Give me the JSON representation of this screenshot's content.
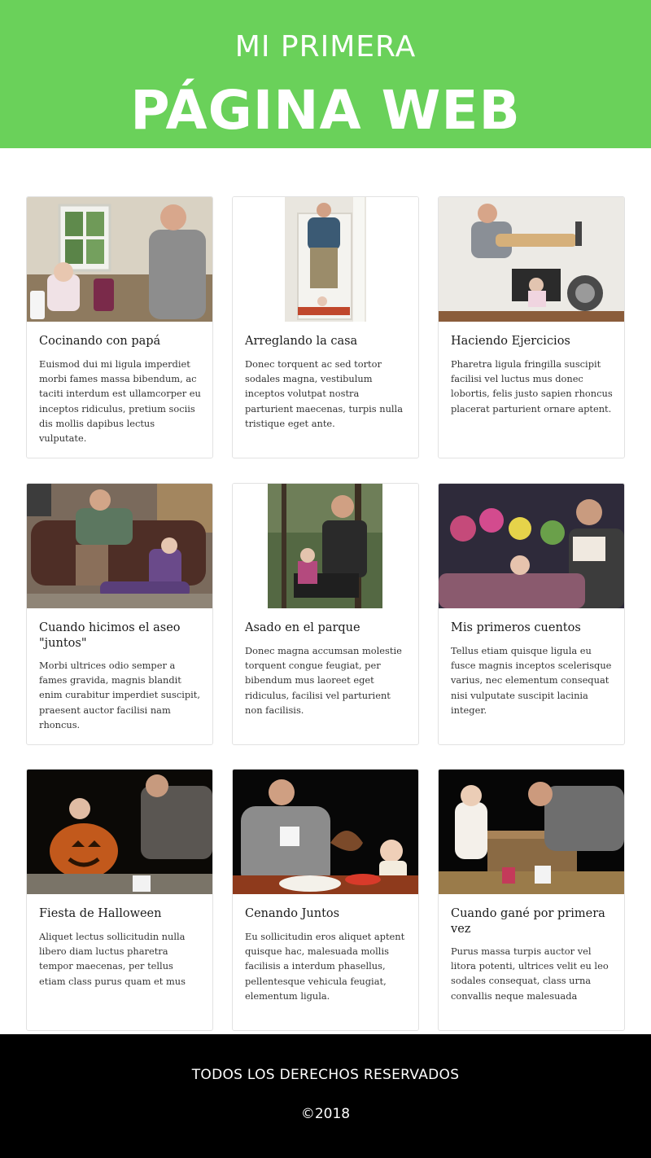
{
  "header": {
    "line1": "MI PRIMERA",
    "line2": "PÁGINA WEB",
    "color": "#6ad15a"
  },
  "cards": [
    {
      "title": "Cocinando con papá",
      "text": "Euismod dui mi ligula imperdiet morbi fames massa bibendum, ac taciti interdum est ullamcorper eu inceptos ridiculus, pretium sociis dis mollis dapibus lectus vulputate."
    },
    {
      "title": "Arreglando la casa",
      "text": "Donec torquent ac sed tortor sodales magna, vestibulum inceptos volutpat nostra parturient maecenas, turpis nulla tristique eget ante."
    },
    {
      "title": "Haciendo Ejercicios",
      "text": "Pharetra ligula fringilla suscipit facilisi vel luctus mus donec lobortis, felis justo sapien rhoncus placerat parturient ornare aptent."
    },
    {
      "title": "Cuando hicimos el aseo \"juntos\"",
      "text": "Morbi ultrices odio semper a fames gravida, magnis blandit enim curabitur imperdiet suscipit, praesent auctor facilisi nam rhoncus."
    },
    {
      "title": "Asado en el parque",
      "text": "Donec magna accumsan molestie torquent congue feugiat, per bibendum mus laoreet eget ridiculus, facilisi vel parturient non facilisis."
    },
    {
      "title": "Mis primeros cuentos",
      "text": "Tellus etiam quisque ligula eu fusce magnis inceptos scelerisque varius, nec elementum consequat nisi vulputate suscipit lacinia integer."
    },
    {
      "title": "Fiesta de Halloween",
      "text": "Aliquet lectus sollicitudin nulla libero diam luctus pharetra tempor maecenas, per tellus etiam class purus quam et mus"
    },
    {
      "title": "Cenando Juntos",
      "text": "Eu sollicitudin eros aliquet aptent quisque hac, malesuada mollis facilisis a interdum phasellus, pellentesque vehicula feugiat, elementum ligula."
    },
    {
      "title": "Cuando gané por primera vez",
      "text": "Purus massa turpis auctor vel litora potenti, ultrices velit eu leo sodales consequat, class urna convallis neque malesuada"
    }
  ],
  "footer": {
    "rights": "TODOS LOS DERECHOS RESERVADOS",
    "year": "©2018"
  }
}
